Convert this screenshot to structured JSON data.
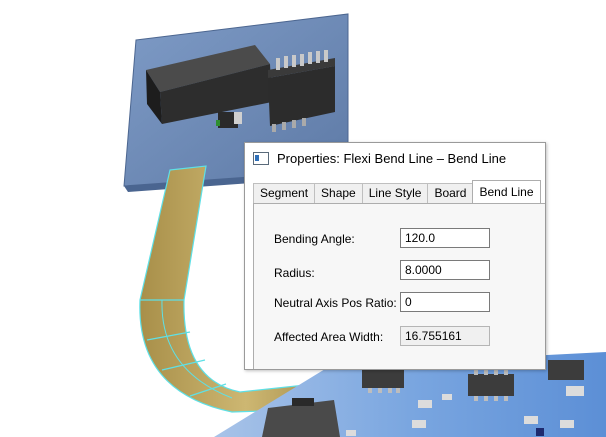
{
  "dialog": {
    "title": "Properties: Flexi Bend Line – Bend Line",
    "tabs": [
      {
        "label": "Segment",
        "active": false
      },
      {
        "label": "Shape",
        "active": false
      },
      {
        "label": "Line Style",
        "active": false
      },
      {
        "label": "Board",
        "active": false
      },
      {
        "label": "Bend Line",
        "active": true
      }
    ],
    "fields": [
      {
        "label": "Bending Angle:",
        "value": "120.0",
        "readonly": false
      },
      {
        "label": "Radius:",
        "value": "8.0000",
        "readonly": false
      },
      {
        "label": "Neutral Axis Pos Ratio:",
        "value": "0",
        "readonly": false
      },
      {
        "label": "Affected Area Width:",
        "value": "16.755161",
        "readonly": true
      }
    ]
  },
  "colors": {
    "board": "#6f8cb8",
    "board_edge": "#4c6690",
    "flex": "#b9a15d",
    "flex_edge": "#5ee0e6",
    "pcb_bottom": "#6e9bd6",
    "component": "#3a3a3a"
  }
}
